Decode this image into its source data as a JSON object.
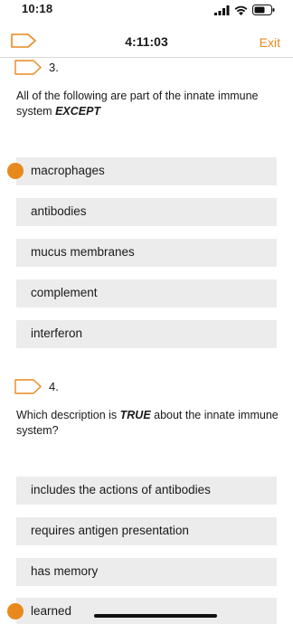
{
  "status_bar": {
    "time": "10:18"
  },
  "nav": {
    "timer": "4:11:03",
    "exit_label": "Exit"
  },
  "colors": {
    "accent": "#e8891e",
    "answer_bg": "#ececec"
  },
  "questions": [
    {
      "number": "3.",
      "text_before": "All of the following are part of the innate immune system ",
      "emphasis": "EXCEPT",
      "text_after": "",
      "answers": [
        {
          "label": "macrophages",
          "selected": true
        },
        {
          "label": "antibodies",
          "selected": false
        },
        {
          "label": "mucus membranes",
          "selected": false
        },
        {
          "label": "complement",
          "selected": false
        },
        {
          "label": "interferon",
          "selected": false
        }
      ]
    },
    {
      "number": "4.",
      "text_before": "Which description is ",
      "emphasis": "TRUE",
      "text_after": " about the innate immune system?",
      "answers": [
        {
          "label": "includes the actions of antibodies",
          "selected": false
        },
        {
          "label": "requires antigen presentation",
          "selected": false
        },
        {
          "label": "has memory",
          "selected": false
        },
        {
          "label": "learned",
          "selected": true
        }
      ]
    }
  ]
}
